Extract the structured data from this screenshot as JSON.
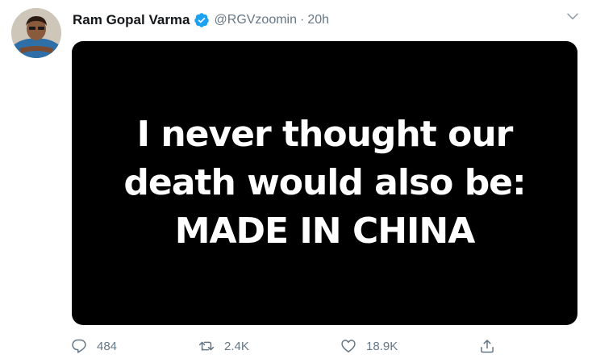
{
  "tweet": {
    "author": {
      "name": "Ram Gopal Varma",
      "handle": "@RGVzoomin",
      "verified": true,
      "avatar_icon": "profile-photo"
    },
    "separator": "·",
    "time": "20h",
    "media": {
      "lines": [
        "I never thought our",
        "death would also be:",
        "MADE IN CHINA"
      ],
      "background_color": "#000000",
      "text_color": "#ffffff"
    },
    "actions": {
      "replies": "484",
      "retweets": "2.4K",
      "likes": "18.9K"
    }
  },
  "colors": {
    "verified_badge": "#1da1f2",
    "secondary_text": "#657786",
    "primary_text": "#14171a"
  }
}
